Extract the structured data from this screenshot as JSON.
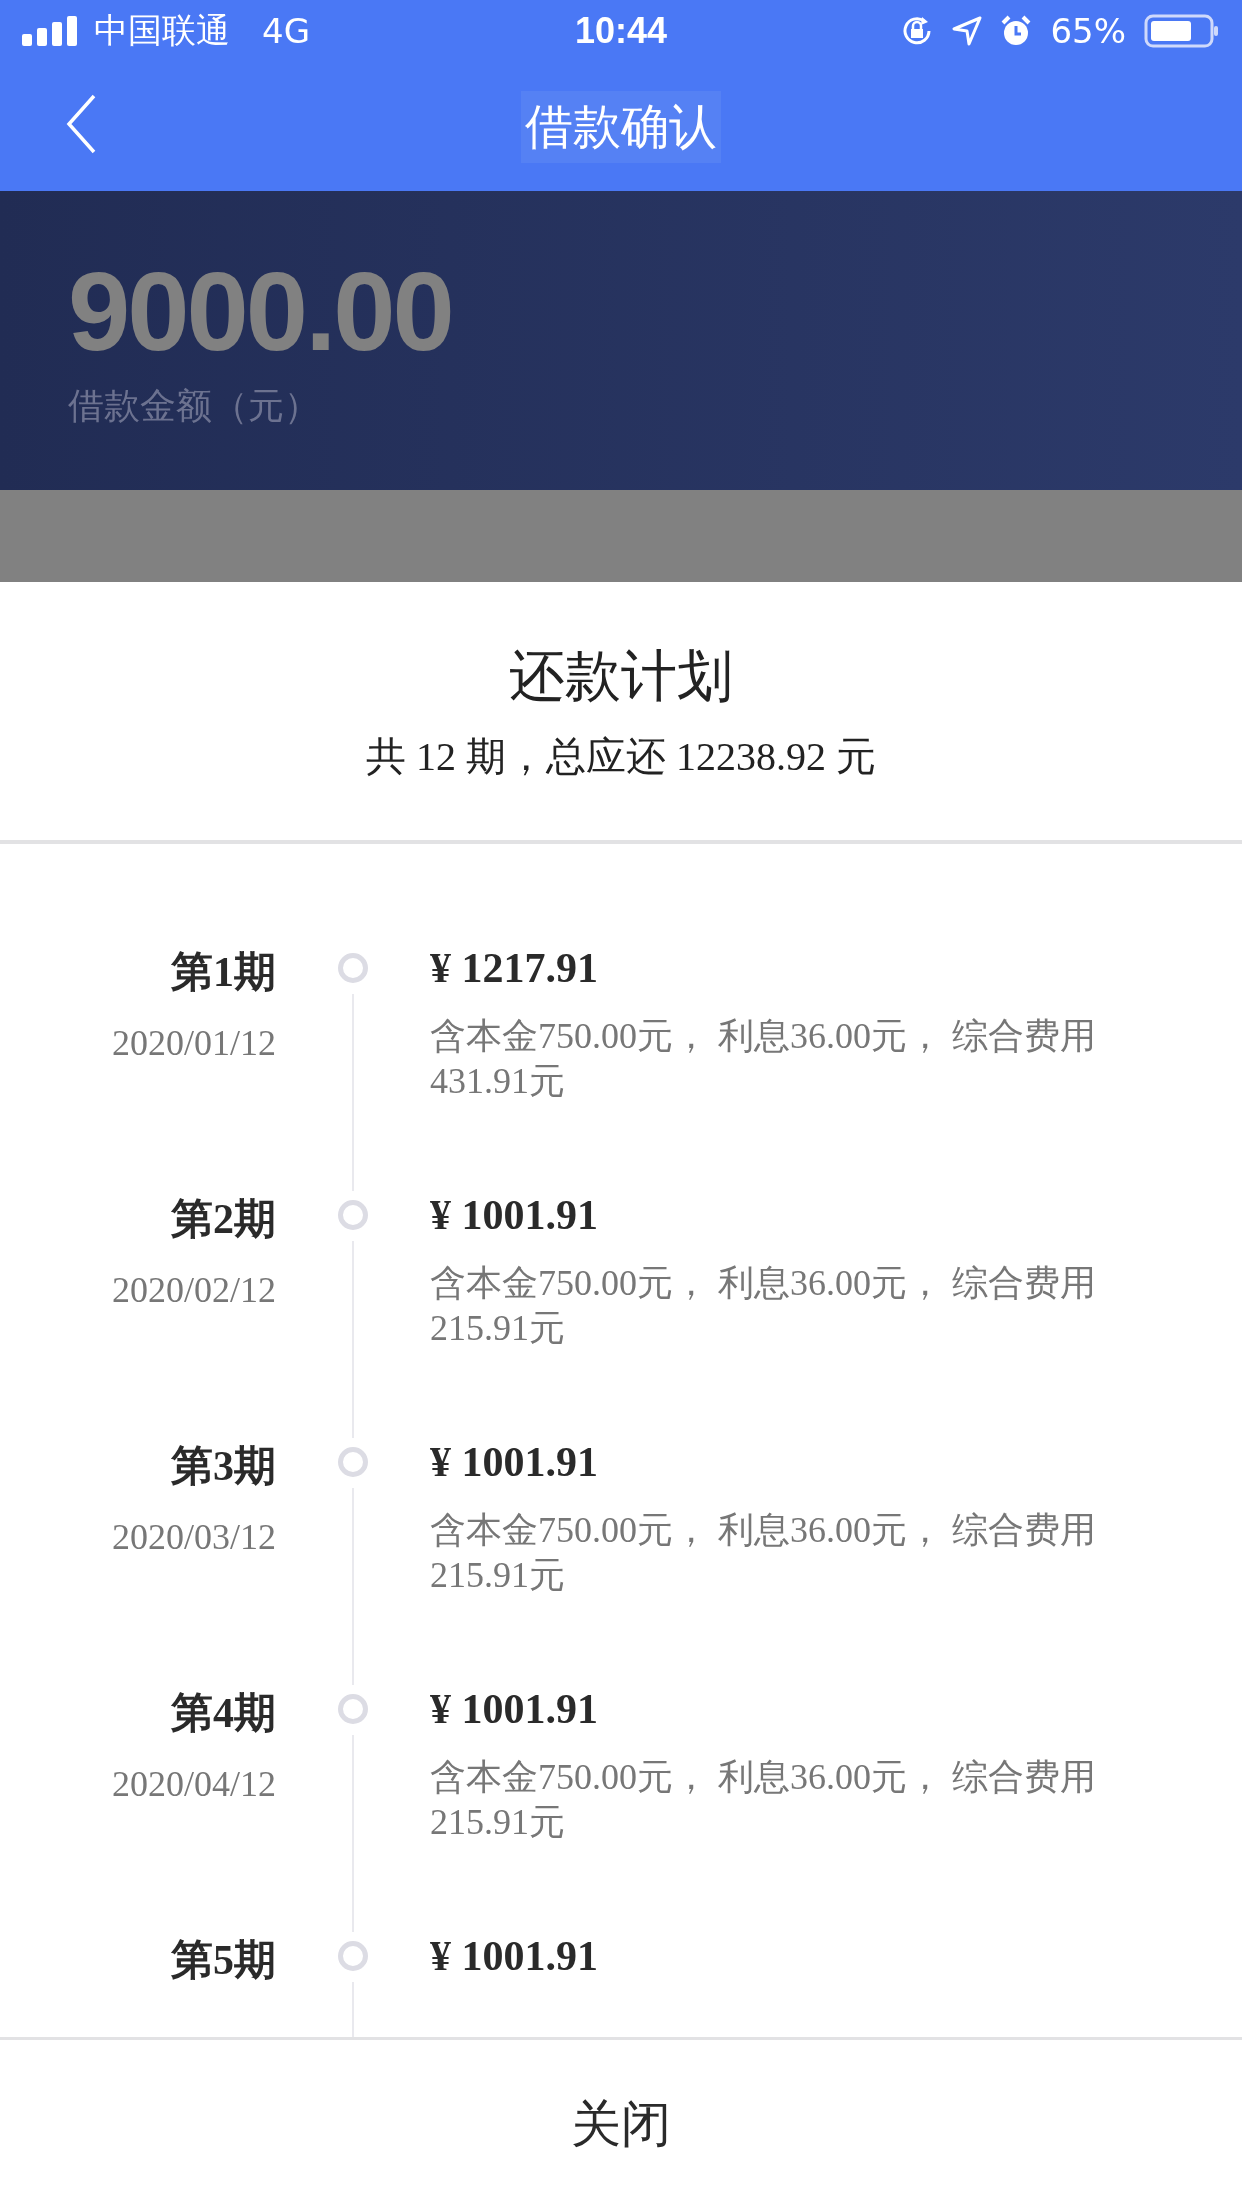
{
  "status_bar": {
    "carrier": "中国联通",
    "network": "4G",
    "time": "10:44",
    "battery": "65%"
  },
  "nav": {
    "title": "借款确认"
  },
  "loan": {
    "amount": "9000.00",
    "label": "借款金额（元）"
  },
  "sheet": {
    "title": "还款计划",
    "summary": "共 12 期，总应还 12238.92 元",
    "installments": [
      {
        "period": "第1期",
        "date": "2020/01/12",
        "amount": "¥ 1217.91",
        "detail": "含本金750.00元， 利息36.00元， 综合费用431.91元"
      },
      {
        "period": "第2期",
        "date": "2020/02/12",
        "amount": "¥ 1001.91",
        "detail": "含本金750.00元， 利息36.00元， 综合费用215.91元"
      },
      {
        "period": "第3期",
        "date": "2020/03/12",
        "amount": "¥ 1001.91",
        "detail": "含本金750.00元， 利息36.00元， 综合费用215.91元"
      },
      {
        "period": "第4期",
        "date": "2020/04/12",
        "amount": "¥ 1001.91",
        "detail": "含本金750.00元， 利息36.00元， 综合费用215.91元"
      },
      {
        "period": "第5期",
        "amount": "¥ 1001.91"
      }
    ],
    "close": "关闭"
  }
}
